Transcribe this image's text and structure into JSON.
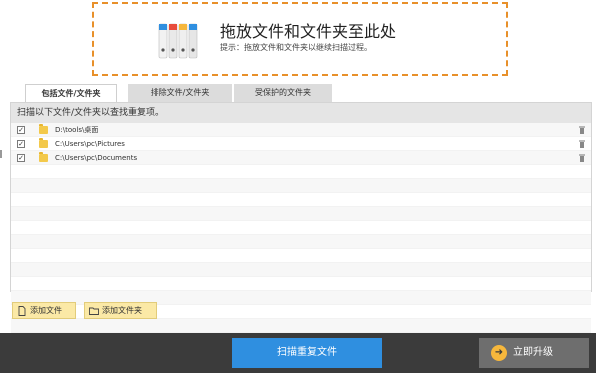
{
  "dropzone": {
    "title": "拖放文件和文件夹至此处",
    "hint": "提示：拖放文件和文件夹以继续扫描过程。",
    "binder_colors": [
      "#f2f2f2",
      "#e9e9e9",
      "#efefef",
      "#e6e6e6"
    ],
    "binder_tips": [
      "#2f8fe0",
      "#e84c3d",
      "#f6b73c",
      "#2f8fe0"
    ]
  },
  "tabs": [
    {
      "label": "包括文件/文件夹",
      "active": true
    },
    {
      "label": "排除文件/文件夹",
      "active": false
    },
    {
      "label": "受保护的文件夹",
      "active": false
    }
  ],
  "panel": {
    "header": "扫描以下文件/文件夹以查找重复项。",
    "rows": [
      {
        "checked": true,
        "path": "D:\\tools\\桌面"
      },
      {
        "checked": true,
        "path": "C:\\Users\\pc\\Pictures"
      },
      {
        "checked": true,
        "path": "C:\\Users\\pc\\Documents"
      }
    ],
    "empty_rows": 12
  },
  "buttons": {
    "add_file": "添加文件",
    "add_folder": "添加文件夹",
    "scan": "扫描重复文件",
    "upgrade": "立即升级"
  },
  "colors": {
    "accent_blue": "#2f8fe0",
    "dashed_border": "#e8902a",
    "footer_bg": "#3b3b3b",
    "upgrade_icon": "#f6b73c"
  }
}
